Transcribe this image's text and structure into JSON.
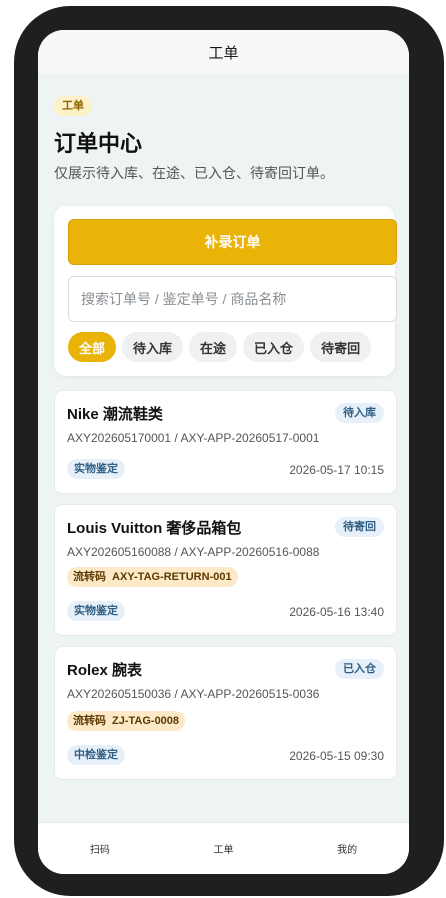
{
  "nav": {
    "title": "工单"
  },
  "header": {
    "tag": "工单",
    "title": "订单中心",
    "subtitle": "仅展示待入库、在途、已入仓、待寄回订单。"
  },
  "panel": {
    "primary_button": "补录订单",
    "search_placeholder": "搜索订单号 / 鉴定单号 / 商品名称",
    "filters": [
      "全部",
      "待入库",
      "在途",
      "已入仓",
      "待寄回"
    ],
    "active_filter": "全部"
  },
  "orders": [
    {
      "title": "Nike 潮流鞋类",
      "status": "待入库",
      "order_no": "AXY202605170001 / AXY-APP-20260517-0001",
      "type": "实物鉴定",
      "time": "2026-05-17 10:15"
    },
    {
      "title": "Louis Vuitton 奢侈品箱包",
      "status": "待寄回",
      "order_no": "AXY202605160088 / AXY-APP-20260516-0088",
      "flow_label": "流转码",
      "flow_code": "AXY-TAG-RETURN-001",
      "type": "实物鉴定",
      "time": "2026-05-16 13:40"
    },
    {
      "title": "Rolex 腕表",
      "status": "已入仓",
      "order_no": "AXY202605150036 / AXY-APP-20260515-0036",
      "flow_label": "流转码",
      "flow_code": "ZJ-TAG-0008",
      "type": "中检鉴定",
      "time": "2026-05-15 09:30"
    }
  ],
  "tabbar": {
    "items": [
      "扫码",
      "工单",
      "我的"
    ],
    "active": "工单"
  },
  "colors": {
    "accent": "#eab308",
    "background": "#eef4f3",
    "badge_blue": "#e7f0f8",
    "badge_orange": "#fde9c8"
  }
}
